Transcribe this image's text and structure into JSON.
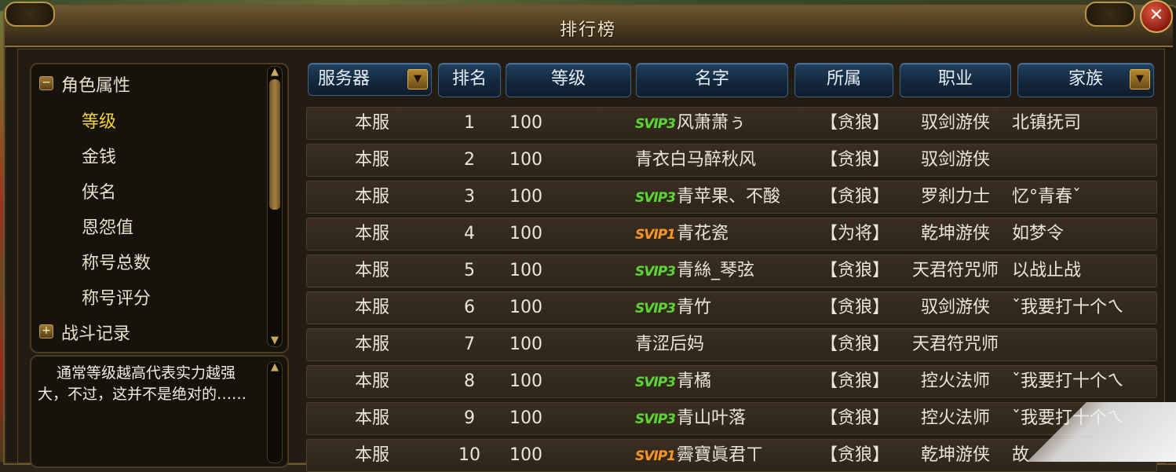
{
  "window": {
    "title": "排行榜",
    "close_symbol": "✕"
  },
  "categories": [
    {
      "label": "角色属性",
      "type": "group",
      "expanded": true,
      "toggle": "−"
    },
    {
      "label": "等级",
      "type": "child",
      "active": true
    },
    {
      "label": "金钱",
      "type": "child"
    },
    {
      "label": "侠名",
      "type": "child"
    },
    {
      "label": "恩怨值",
      "type": "child"
    },
    {
      "label": "称号总数",
      "type": "child"
    },
    {
      "label": "称号评分",
      "type": "child"
    },
    {
      "label": "战斗记录",
      "type": "group",
      "expanded": false,
      "toggle": "+"
    }
  ],
  "description": "通常等级越高代表实力越强大，不过，这并不是绝对的……",
  "table": {
    "headers": {
      "server": "服务器",
      "rank": "排名",
      "level": "等级",
      "name": "名字",
      "belong": "所属",
      "job": "职业",
      "family": "家族"
    },
    "dropdown_symbol": "▼",
    "rows": [
      {
        "server": "本服",
        "rank": "1",
        "level": "100",
        "vip": "SVIP3",
        "vip_color": "green",
        "name": "风萧萧ぅ",
        "belong": "【贪狼】",
        "job": "驭剑游侠",
        "family": "北镇抚司"
      },
      {
        "server": "本服",
        "rank": "2",
        "level": "100",
        "vip": "",
        "vip_color": "",
        "name": "青衣白马醉秋风",
        "belong": "【贪狼】",
        "job": "驭剑游侠",
        "family": ""
      },
      {
        "server": "本服",
        "rank": "3",
        "level": "100",
        "vip": "SVIP3",
        "vip_color": "green",
        "name": "青苹果、不酸",
        "belong": "【贪狼】",
        "job": "罗刹力士",
        "family": "忆°青春ˇ"
      },
      {
        "server": "本服",
        "rank": "4",
        "level": "100",
        "vip": "SVIP1",
        "vip_color": "orange",
        "name": "青花瓷",
        "belong": "【为将】",
        "job": "乾坤游侠",
        "family": "如梦令"
      },
      {
        "server": "本服",
        "rank": "5",
        "level": "100",
        "vip": "SVIP3",
        "vip_color": "green",
        "name": "青絲_琴弦",
        "belong": "【贪狼】",
        "job": "天君符咒师",
        "family": "以战止战"
      },
      {
        "server": "本服",
        "rank": "6",
        "level": "100",
        "vip": "SVIP3",
        "vip_color": "green",
        "name": "青竹",
        "belong": "【贪狼】",
        "job": "驭剑游侠",
        "family": "ˇ我要打十个ㄟ"
      },
      {
        "server": "本服",
        "rank": "7",
        "level": "100",
        "vip": "",
        "vip_color": "",
        "name": "青涩后妈",
        "belong": "【贪狼】",
        "job": "天君符咒师",
        "family": ""
      },
      {
        "server": "本服",
        "rank": "8",
        "level": "100",
        "vip": "SVIP3",
        "vip_color": "green",
        "name": "青橘",
        "belong": "【贪狼】",
        "job": "控火法师",
        "family": "ˇ我要打十个ㄟ"
      },
      {
        "server": "本服",
        "rank": "9",
        "level": "100",
        "vip": "SVIP3",
        "vip_color": "green",
        "name": "青山叶落",
        "belong": "【贪狼】",
        "job": "控火法师",
        "family": "ˇ我要打十个ㄟ"
      },
      {
        "server": "本服",
        "rank": "10",
        "level": "100",
        "vip": "SVIP1",
        "vip_color": "orange",
        "name": "霽寶眞君ㄒ",
        "belong": "【贪狼】",
        "job": "乾坤游侠",
        "family": "故"
      }
    ]
  },
  "colors": {
    "active_category": "#f2d230",
    "header_bg": "#14283e",
    "vip_green": "#5fd23a",
    "vip_orange": "#f0962a"
  }
}
